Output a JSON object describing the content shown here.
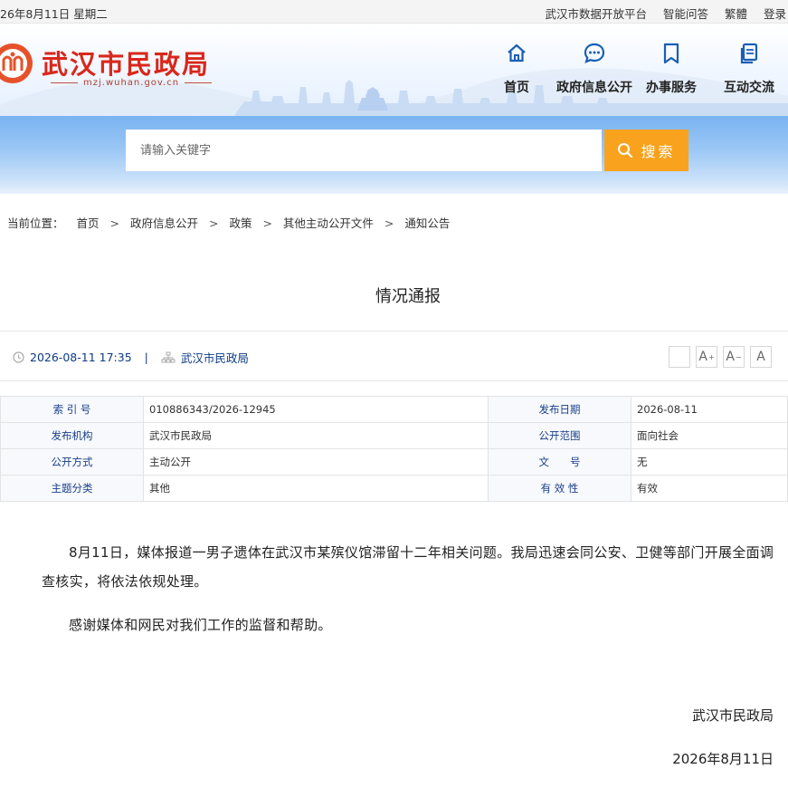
{
  "topbar": {
    "date": "26年8月11日 星期二",
    "links": [
      "武汉市数据开放平台",
      "智能问答",
      "繁體",
      "登录"
    ]
  },
  "header": {
    "site_title": "武汉市民政局",
    "site_url": "mzj.wuhan.gov.cn",
    "nav": [
      {
        "label": "首页",
        "icon": "home-icon"
      },
      {
        "label": "政府信息公开",
        "icon": "chat-icon"
      },
      {
        "label": "办事服务",
        "icon": "bookmark-icon"
      },
      {
        "label": "互动交流",
        "icon": "document-icon"
      }
    ]
  },
  "search": {
    "placeholder": "请输入关键字",
    "button_label": "搜索"
  },
  "breadcrumb": {
    "prefix": "当前位置：",
    "items": [
      "首页",
      "政府信息公开",
      "政策",
      "其他主动公开文件",
      "通知公告"
    ],
    "separator": ">"
  },
  "article": {
    "title": "情况通报",
    "datetime": "2026-08-11 17:35",
    "publisher": "武汉市民政局",
    "font_buttons": [
      "",
      "A+",
      "A-",
      "A"
    ]
  },
  "info": {
    "rows": [
      [
        {
          "label": "索 引 号",
          "value": "010886343/2026-12945"
        },
        {
          "label": "发布日期",
          "value": "2026-08-11"
        }
      ],
      [
        {
          "label": "发布机构",
          "value": "武汉市民政局"
        },
        {
          "label": "公开范围",
          "value": "面向社会"
        }
      ],
      [
        {
          "label": "公开方式",
          "value": "主动公开"
        },
        {
          "label": "文　　号",
          "value": "无"
        }
      ],
      [
        {
          "label": "主题分类",
          "value": "其他"
        },
        {
          "label": "有 效 性",
          "value": "有效"
        }
      ]
    ]
  },
  "body": {
    "paragraphs": [
      "8月11日，媒体报道一男子遗体在武汉市某殡仪馆滞留十二年相关问题。我局迅速会同公安、卫健等部门开展全面调查核实，将依法依规处理。",
      "感谢媒体和网民对我们工作的监督和帮助。"
    ],
    "signature_org": "武汉市民政局",
    "signature_date": "2026年8月11日"
  },
  "colors": {
    "brand_red": "#d9271b",
    "link_blue": "#0c3b85",
    "search_orange": "#f9a21d",
    "banner_blue": "#79b3f0"
  }
}
